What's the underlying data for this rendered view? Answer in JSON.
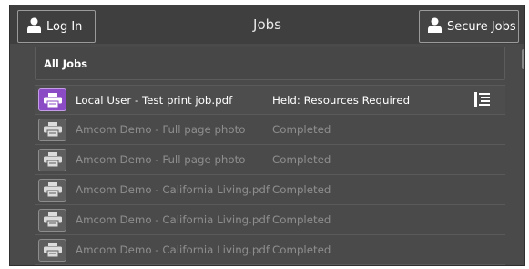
{
  "header": {
    "login_label": "Log In",
    "title": "Jobs",
    "secure_jobs_label": "Secure Jobs"
  },
  "filter": {
    "label": "All Jobs"
  },
  "jobs": [
    {
      "name": "Local User - Test print job.pdf",
      "status": "Held: Resources Required",
      "state": "active",
      "icon": "printer-icon"
    },
    {
      "name": "Amcom Demo - Full page photo",
      "status": "Completed",
      "state": "completed",
      "icon": "printer-icon"
    },
    {
      "name": "Amcom Demo - Full page photo",
      "status": "Completed",
      "state": "completed",
      "icon": "printer-icon"
    },
    {
      "name": "Amcom Demo - California Living.pdf",
      "status": "Completed",
      "state": "completed",
      "icon": "printer-icon"
    },
    {
      "name": "Amcom Demo - California Living.pdf",
      "status": "Completed",
      "state": "completed",
      "icon": "printer-icon"
    },
    {
      "name": "Amcom Demo - California Living.pdf",
      "status": "Completed",
      "state": "completed",
      "icon": "printer-icon"
    }
  ],
  "colors": {
    "background": "#4a4a4a",
    "header": "#3f3f3f",
    "active_icon": "#8a4bc4",
    "dim_text": "#8e8e8e"
  }
}
